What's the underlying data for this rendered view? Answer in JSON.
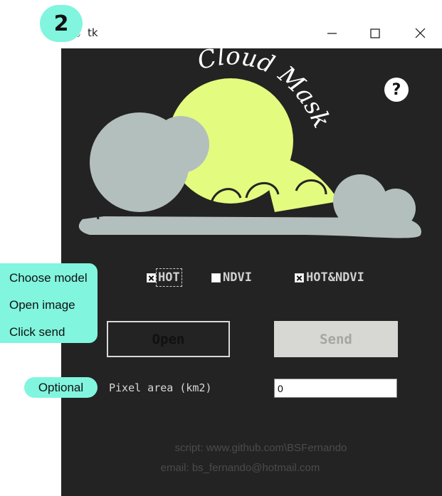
{
  "window": {
    "title": "tk",
    "app_icon": "feather-icon",
    "controls": {
      "minimize": "minimize-icon",
      "maximize": "maximize-icon",
      "close": "close-icon"
    }
  },
  "logo": {
    "text": "Cloud Mask"
  },
  "help": {
    "label": "?"
  },
  "model_options": [
    {
      "label": "HOT",
      "checked": true,
      "focused": true
    },
    {
      "label": "NDVI",
      "checked": false,
      "focused": false
    },
    {
      "label": "HOT&NDVI",
      "checked": true,
      "focused": false
    }
  ],
  "buttons": {
    "open": "Open",
    "send": "Send",
    "send_enabled": false
  },
  "pixel_area": {
    "label": "Pixel area (km2)",
    "value": "0"
  },
  "footer": {
    "script": "script: www.github.com\\BSFernando",
    "email": "email: bs_fernando@hotmail.com"
  },
  "annotations": {
    "step_number": "2",
    "steps": [
      "Choose model",
      "Open image",
      "Click send"
    ],
    "optional": "Optional"
  },
  "colors": {
    "background": "#232323",
    "sun": "#e3fb7f",
    "cloud": "#b3bfbc",
    "annotation": "#81f5de",
    "disabled_button": "#d7d7d3"
  }
}
